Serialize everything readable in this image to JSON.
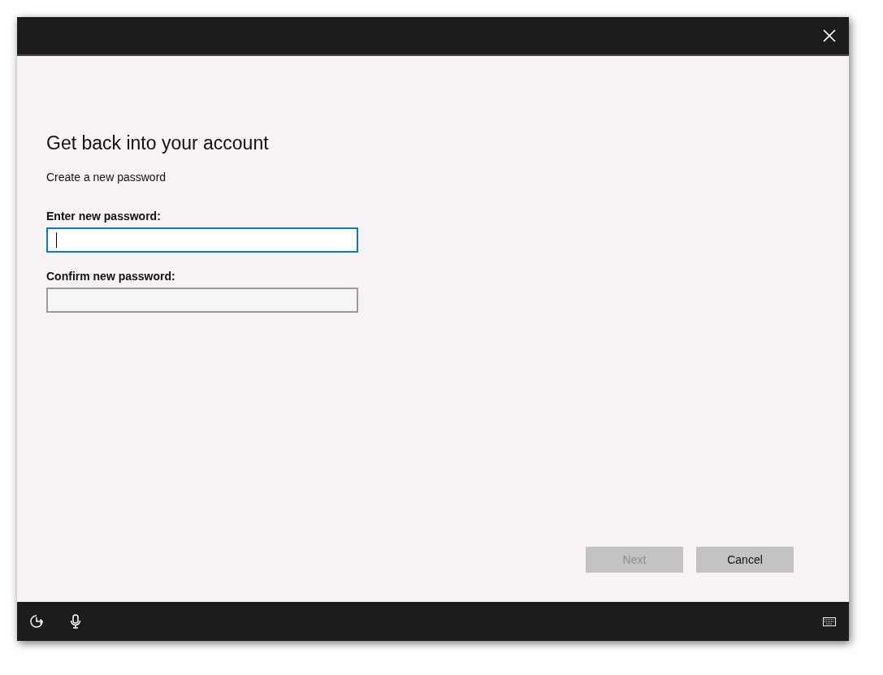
{
  "dialog": {
    "heading": "Get back into your account",
    "subtitle": "Create a new password"
  },
  "fields": [
    {
      "label": "Enter new password:",
      "focused": true
    },
    {
      "label": "Confirm new password:",
      "focused": false
    }
  ],
  "buttons": [
    {
      "label": "Next",
      "disabled": true
    },
    {
      "label": "Cancel",
      "disabled": false
    }
  ]
}
